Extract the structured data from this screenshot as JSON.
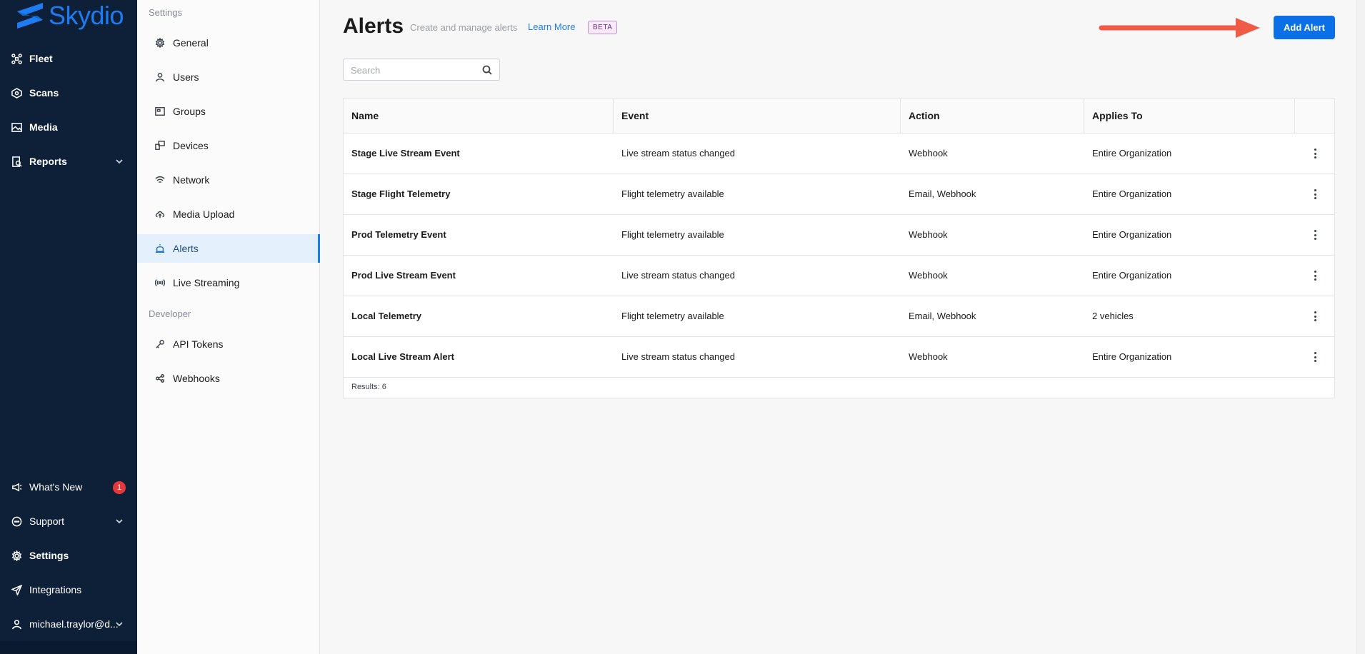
{
  "brand": {
    "name": "Skydio",
    "color": "#1e7cf2"
  },
  "primary_nav": {
    "items": [
      {
        "label": "Fleet",
        "icon": "fleet-drone-icon"
      },
      {
        "label": "Scans",
        "icon": "scans-icon"
      },
      {
        "label": "Media",
        "icon": "media-image-icon"
      },
      {
        "label": "Reports",
        "icon": "reports-icon",
        "has_chevron": true
      }
    ],
    "bottom_items": [
      {
        "label": "What's New",
        "icon": "megaphone-icon",
        "badge": "1"
      },
      {
        "label": "Support",
        "icon": "chat-bubble-icon",
        "has_chevron": true
      },
      {
        "label": "Settings",
        "icon": "gear-icon",
        "active": true
      },
      {
        "label": "Integrations",
        "icon": "send-plane-icon"
      },
      {
        "label": "michael.traylor@d...",
        "icon": "user-icon",
        "has_chevron": true
      }
    ]
  },
  "settings_sidebar": {
    "section_settings": "Settings",
    "items": [
      {
        "label": "General",
        "icon": "gear-icon"
      },
      {
        "label": "Users",
        "icon": "user-icon"
      },
      {
        "label": "Groups",
        "icon": "groups-icon"
      },
      {
        "label": "Devices",
        "icon": "devices-icon"
      },
      {
        "label": "Network",
        "icon": "wifi-icon"
      },
      {
        "label": "Media Upload",
        "icon": "cloud-upload-icon"
      },
      {
        "label": "Alerts",
        "icon": "alarm-icon",
        "active": true
      },
      {
        "label": "Live Streaming",
        "icon": "broadcast-icon"
      }
    ],
    "section_developer": "Developer",
    "dev_items": [
      {
        "label": "API Tokens",
        "icon": "key-icon"
      },
      {
        "label": "Webhooks",
        "icon": "webhook-icon"
      }
    ]
  },
  "page": {
    "title": "Alerts",
    "subtitle": "Create and manage alerts",
    "learn_more": "Learn More",
    "beta_badge": "BETA",
    "add_button": "Add Alert"
  },
  "search": {
    "placeholder": "Search",
    "value": ""
  },
  "table": {
    "columns": [
      "Name",
      "Event",
      "Action",
      "Applies To"
    ],
    "rows": [
      {
        "name": "Stage Live Stream Event",
        "event": "Live stream status changed",
        "action": "Webhook",
        "applies_to": "Entire Organization"
      },
      {
        "name": "Stage Flight Telemetry",
        "event": "Flight telemetry available",
        "action": "Email, Webhook",
        "applies_to": "Entire Organization"
      },
      {
        "name": "Prod Telemetry Event",
        "event": "Flight telemetry available",
        "action": "Webhook",
        "applies_to": "Entire Organization"
      },
      {
        "name": "Prod Live Stream Event",
        "event": "Live stream status changed",
        "action": "Webhook",
        "applies_to": "Entire Organization"
      },
      {
        "name": "Local Telemetry",
        "event": "Flight telemetry available",
        "action": "Email, Webhook",
        "applies_to": "2 vehicles"
      },
      {
        "name": "Local Live Stream Alert",
        "event": "Live stream status changed",
        "action": "Webhook",
        "applies_to": "Entire Organization"
      }
    ],
    "results": "Results: 6"
  },
  "colors": {
    "nav_bg": "#0e2038",
    "accent": "#0b6fe8",
    "active_bg": "#e4f1fc",
    "annotation_arrow": "#ef5b47"
  }
}
